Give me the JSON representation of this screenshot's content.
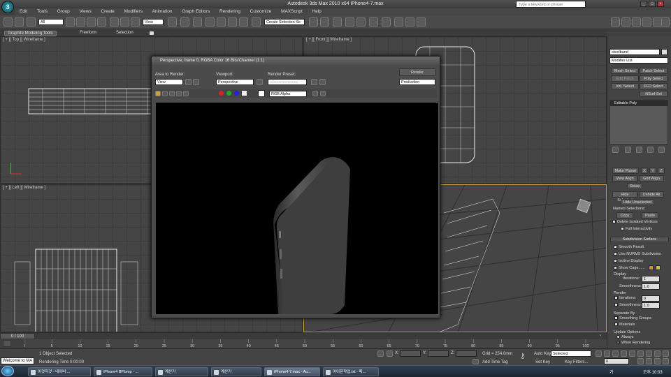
{
  "window": {
    "title": "Autodesk 3ds Max  2010 x64      iPhone4-7.max",
    "logo_text": "3",
    "search_placeholder": "Type a keyword or phrase",
    "min": "_",
    "max": "□",
    "close": "×"
  },
  "menu": [
    "Edit",
    "Tools",
    "Group",
    "Views",
    "Create",
    "Modifiers",
    "Animation",
    "Graph Editors",
    "Rendering",
    "Customize",
    "MAXScript",
    "Help"
  ],
  "toolbar": {
    "selection_filter": "All",
    "ref_coord": "View",
    "named_selection": "Create Selection Se"
  },
  "ribbon": {
    "tabs": [
      "Graphite Modeling Tools",
      "Freeform",
      "Selection"
    ]
  },
  "viewports": {
    "top": "[ + ][ Top ][ Wireframe ]",
    "front": "[ + ][ Front ][ Wireframe ]",
    "left": "[ + ][ Left ][ Wireframe ]"
  },
  "render_window": {
    "title": "Perspective, frame 0, RGBA Color 16 Bits/Channel (1:1)",
    "area_label": "Area to Render:",
    "area_value": "View",
    "viewport_label": "Viewport:",
    "viewport_value": "Perspective",
    "preset_label": "Render Preset:",
    "preset_value": "----------------------",
    "render_button": "Render",
    "production": "Production",
    "channel": "RGB Alpha"
  },
  "command_panel": {
    "object_name": "steelband",
    "modifier_list": "Modifier List",
    "buttons": [
      "Mesh Select",
      "Patch Select",
      "Edit Patch",
      "Poly Select",
      "Vol. Select",
      "FFD Select",
      "",
      "NSurf Sel"
    ],
    "stack_item": "Editable Poly",
    "edit_buttons": [
      "Make Planar",
      "X",
      "Y",
      "Z",
      "View Align",
      "Grid Align",
      "Relax",
      "Hide Selected",
      "Unhide All",
      "Hide Unselected",
      "Copy",
      "Paste"
    ],
    "named_selections": "Named Selections:",
    "delete_isolated": "Delete Isolated Vertices",
    "full_interactivity": "Full Interactivity",
    "subdivision_header": "Subdivision Surface",
    "smooth_result": "Smooth Result",
    "use_nurms": "Use NURMS Subdivision",
    "isoline": "Isoline Display",
    "show_cage": "Show Cage......",
    "display_label": "Display",
    "iterations_label": "Iterations:",
    "iterations_value": "1",
    "smoothness_label": "Smoothness:",
    "smoothness_value": "1.0",
    "render_label": "Render",
    "r_iterations_value": "0",
    "r_smoothness_value": "1.0",
    "separate_by": "Separate By",
    "smoothing_groups": "Smoothing Groups",
    "materials": "Materials",
    "update_options": "Update Options",
    "always": "Always",
    "when_rendering": "When Rendering",
    "cage_colors": [
      "#e08a1e",
      "#c8c82a"
    ]
  },
  "timeline": {
    "frame": "0 / 100",
    "ticks": [
      "0",
      "5",
      "10",
      "15",
      "20",
      "25",
      "30",
      "35",
      "40",
      "45",
      "50",
      "55",
      "60",
      "65",
      "70",
      "75",
      "80",
      "85",
      "90",
      "95",
      "100"
    ]
  },
  "status": {
    "welcome": "Welcome to MA",
    "selected": "1 Object Selected",
    "render_time": "Rendering Time  0:00:00",
    "grid": "Grid = 254.0mm",
    "add_time_tag": "Add Time Tag",
    "auto_key": "Auto Key",
    "set_key": "Set Key",
    "key_mode": "Selected",
    "key_filters": "Key Filters...",
    "frame_value": "0",
    "x_label": "X:",
    "y_label": "Y:",
    "z_label": "Z:"
  },
  "taskbar": {
    "items": [
      "이것저것 - 네이버 ...",
      "iPhone4 BP.bmp - ...",
      "계산기",
      "계산기",
      "iPhone4-7.max - Au...",
      "아이폰작업.txt - 메..."
    ],
    "lang": "가",
    "time": "오후 10:03"
  }
}
